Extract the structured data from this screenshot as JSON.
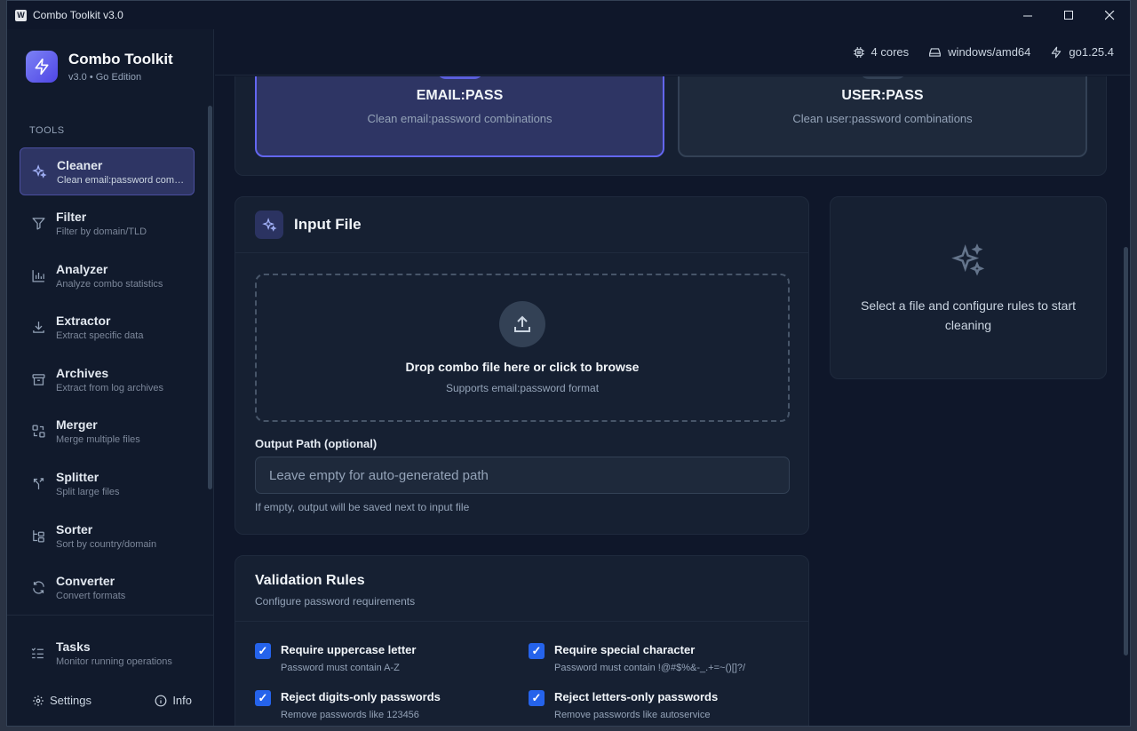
{
  "window": {
    "title": "Combo Toolkit v3.0",
    "app_icon_letter": "W"
  },
  "brand": {
    "title": "Combo Toolkit",
    "subtitle": "v3.0 • Go Edition"
  },
  "sidebar": {
    "section_label": "TOOLS",
    "items": [
      {
        "label": "Cleaner",
        "desc": "Clean email:password combinations",
        "icon": "sparkles-icon",
        "active": true
      },
      {
        "label": "Filter",
        "desc": "Filter by domain/TLD",
        "icon": "filter-icon"
      },
      {
        "label": "Analyzer",
        "desc": "Analyze combo statistics",
        "icon": "bar-chart-icon"
      },
      {
        "label": "Extractor",
        "desc": "Extract specific data",
        "icon": "download-icon"
      },
      {
        "label": "Archives",
        "desc": "Extract from log archives",
        "icon": "archive-icon"
      },
      {
        "label": "Merger",
        "desc": "Merge multiple files",
        "icon": "merge-icon"
      },
      {
        "label": "Splitter",
        "desc": "Split large files",
        "icon": "split-icon"
      },
      {
        "label": "Sorter",
        "desc": "Sort by country/domain",
        "icon": "sort-icon"
      },
      {
        "label": "Converter",
        "desc": "Convert formats",
        "icon": "refresh-icon"
      }
    ],
    "tasks": {
      "label": "Tasks",
      "desc": "Monitor running operations"
    },
    "settings_label": "Settings",
    "info_label": "Info"
  },
  "topbar": {
    "cores": "4 cores",
    "platform": "windows/amd64",
    "go_version": "go1.25.4"
  },
  "modes": [
    {
      "title": "EMAIL:PASS",
      "desc": "Clean email:password combinations",
      "selected": true
    },
    {
      "title": "USER:PASS",
      "desc": "Clean user:password combinations",
      "selected": false
    }
  ],
  "input_file": {
    "title": "Input File",
    "drop_title": "Drop combo file here or click to browse",
    "drop_sub": "Supports email:password format",
    "output_label": "Output Path (optional)",
    "output_placeholder": "Leave empty for auto-generated path",
    "output_value": "",
    "output_hint": "If empty, output will be saved next to input file"
  },
  "status_panel": {
    "text": "Select a file and configure rules to start cleaning"
  },
  "validation": {
    "title": "Validation Rules",
    "subtitle": "Configure password requirements",
    "rules": [
      {
        "title": "Require uppercase letter",
        "desc": "Password must contain A-Z",
        "checked": true
      },
      {
        "title": "Require special character",
        "desc": "Password must contain !@#$%&-_.+=~()[]?/",
        "checked": true
      },
      {
        "title": "Reject digits-only passwords",
        "desc": "Remove passwords like 123456",
        "checked": true
      },
      {
        "title": "Reject letters-only passwords",
        "desc": "Remove passwords like autoservice",
        "checked": true
      }
    ]
  },
  "colors": {
    "accent": "#6366f1",
    "background": "#0f172a",
    "card": "#162032",
    "checkbox": "#2563eb"
  }
}
